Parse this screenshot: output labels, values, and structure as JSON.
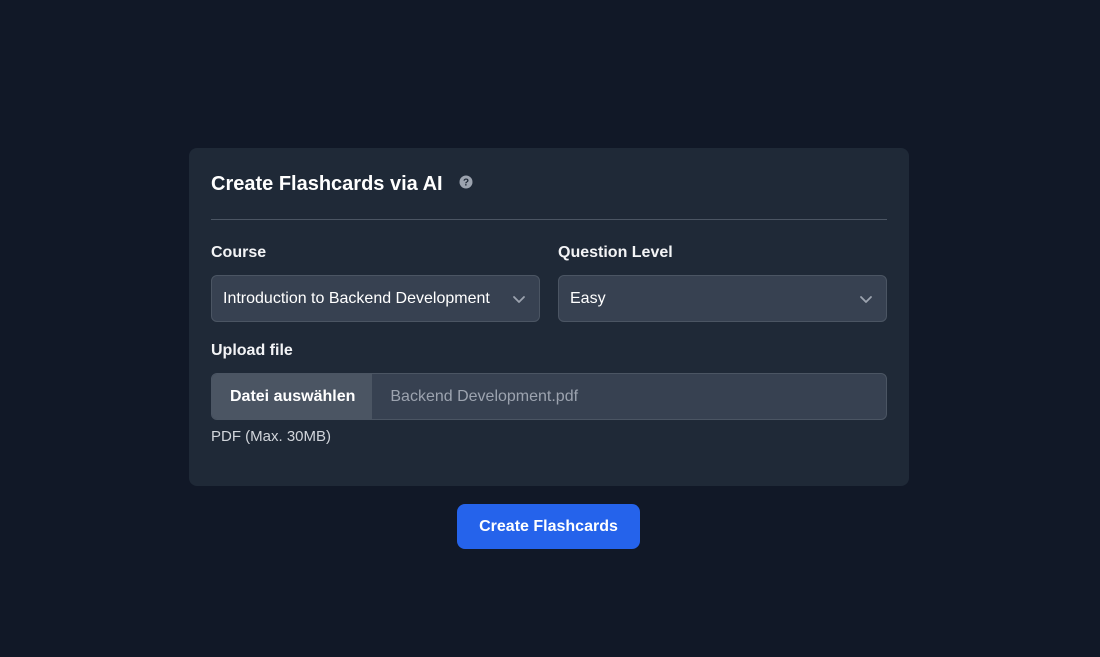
{
  "card": {
    "title": "Create Flashcards via AI",
    "help_icon": "question-circle-icon"
  },
  "course": {
    "label": "Course",
    "selected": "Introduction to Backend Development",
    "icon": "chevron-down-icon"
  },
  "question_level": {
    "label": "Question Level",
    "selected": "Easy",
    "icon": "chevron-down-icon"
  },
  "upload": {
    "label": "Upload file",
    "button_label": "Datei auswählen",
    "file_name": "Backend Development.pdf",
    "hint": "PDF (Max. 30MB)"
  },
  "submit": {
    "label": "Create Flashcards"
  },
  "colors": {
    "page_bg": "#111827",
    "card_bg": "#1f2937",
    "input_bg": "#374151",
    "accent": "#2563eb"
  }
}
